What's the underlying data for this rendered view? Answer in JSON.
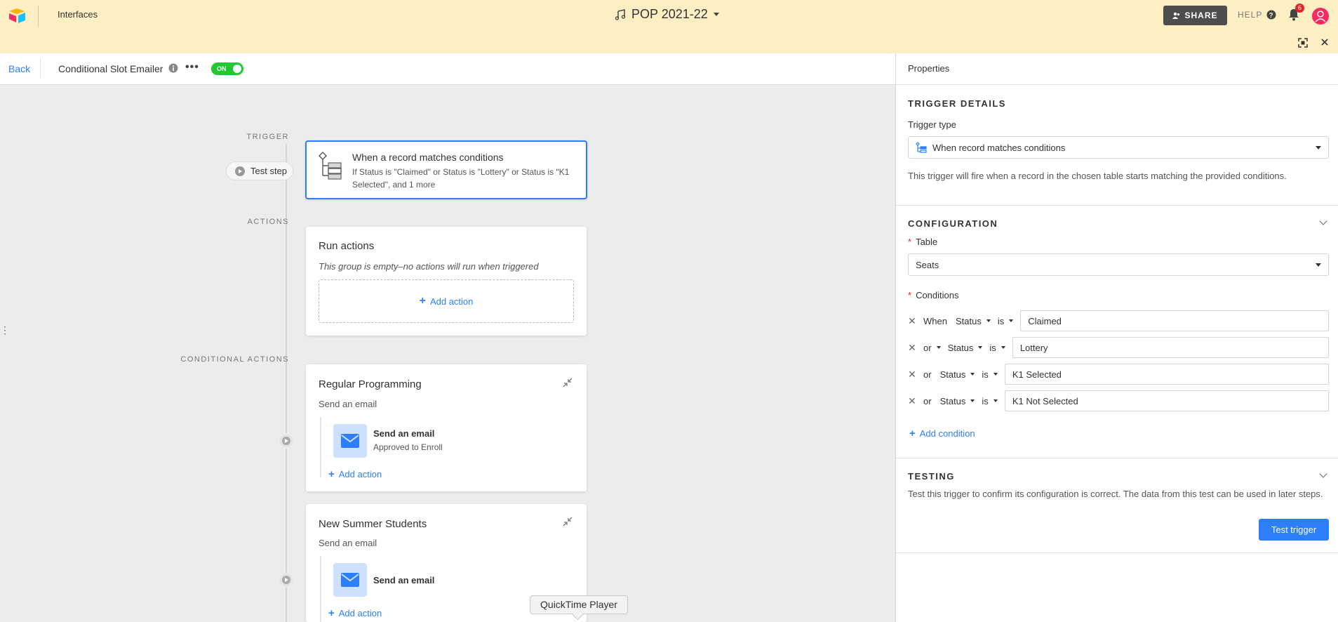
{
  "app": {
    "nav_label": "Interfaces",
    "base_name": "POP 2021-22",
    "share_label": "SHARE",
    "help_label": "HELP",
    "notification_count": "6"
  },
  "automation": {
    "back_label": "Back",
    "name": "Conditional Slot Emailer",
    "toggle_label": "ON"
  },
  "canvas": {
    "trigger_label": "TRIGGER",
    "actions_label": "ACTIONS",
    "conditional_label": "CONDITIONAL ACTIONS",
    "test_step_label": "Test step",
    "trigger": {
      "title": "When a record matches conditions",
      "description": "If Status is \"Claimed\" or Status is \"Lottery\" or Status is \"K1 Selected\", and 1 more"
    },
    "run_actions": {
      "title": "Run actions",
      "empty_note": "This group is empty–no actions will run when triggered",
      "add_action": "Add action"
    },
    "groups": [
      {
        "title": "Regular Programming",
        "subtitle": "Send an email",
        "action_title": "Send an email",
        "action_detail": "Approved to Enroll",
        "add_action": "Add action"
      },
      {
        "title": "New Summer Students",
        "subtitle": "Send an email",
        "action_title": "Send an email",
        "add_action": "Add action"
      }
    ],
    "tooltip": "QuickTime Player"
  },
  "properties": {
    "header": "Properties",
    "trigger_details": {
      "section_title": "TRIGGER DETAILS",
      "type_label": "Trigger type",
      "type_value": "When record matches conditions",
      "help": "This trigger will fire when a record in the chosen table starts matching the provided conditions."
    },
    "configuration": {
      "section_title": "CONFIGURATION",
      "table_label": "Table",
      "table_value": "Seats",
      "conditions_label": "Conditions",
      "conditions": [
        {
          "conj": "When",
          "field": "Status",
          "op": "is",
          "value": "Claimed"
        },
        {
          "conj": "or",
          "field": "Status",
          "op": "is",
          "value": "Lottery"
        },
        {
          "conj": "or",
          "field": "Status",
          "op": "is",
          "value": "K1 Selected"
        },
        {
          "conj": "or",
          "field": "Status",
          "op": "is",
          "value": "K1 Not Selected"
        }
      ],
      "add_condition": "Add condition"
    },
    "testing": {
      "section_title": "TESTING",
      "help": "Test this trigger to confirm its configuration is correct. The data from this test can be used in later steps.",
      "button": "Test trigger"
    }
  },
  "colors": {
    "topbar": "#fdefc3",
    "accent": "#2d7ff9",
    "toggle_on": "#20c933",
    "email_tile": "#cfe0fc"
  }
}
